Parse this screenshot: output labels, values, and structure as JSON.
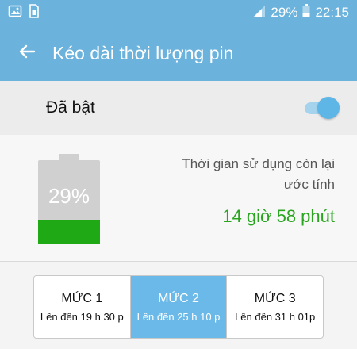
{
  "status_bar": {
    "battery_percent": "29%",
    "time": "22:15"
  },
  "app_bar": {
    "title": "Kéo dài thời lượng pin"
  },
  "toggle": {
    "label": "Đã bật",
    "on": true
  },
  "battery": {
    "percent_text": "29%",
    "level": 0.29,
    "remaining_label_line1": "Thời gian sử dụng còn lại",
    "remaining_label_line2": "ước tính",
    "remaining_value": "14 giờ 58 phút"
  },
  "levels": [
    {
      "name": "MỨC 1",
      "desc": "Lên đến 19 h 30 p",
      "selected": false
    },
    {
      "name": "MỨC 2",
      "desc": "Lên đến 25 h 10 p",
      "selected": true
    },
    {
      "name": "MỨC 3",
      "desc": "Lên đến 31 h 01p",
      "selected": false
    }
  ],
  "colors": {
    "app_bar": "#6bb2dc",
    "battery_fill": "#1fa914",
    "accent_green": "#29a51f",
    "selected_level": "#6bb9e8"
  },
  "icons": {
    "status_left": [
      "image-icon",
      "sim-card-icon"
    ],
    "status_right": [
      "signal-icon",
      "battery-icon"
    ],
    "back": "back-arrow-icon"
  }
}
